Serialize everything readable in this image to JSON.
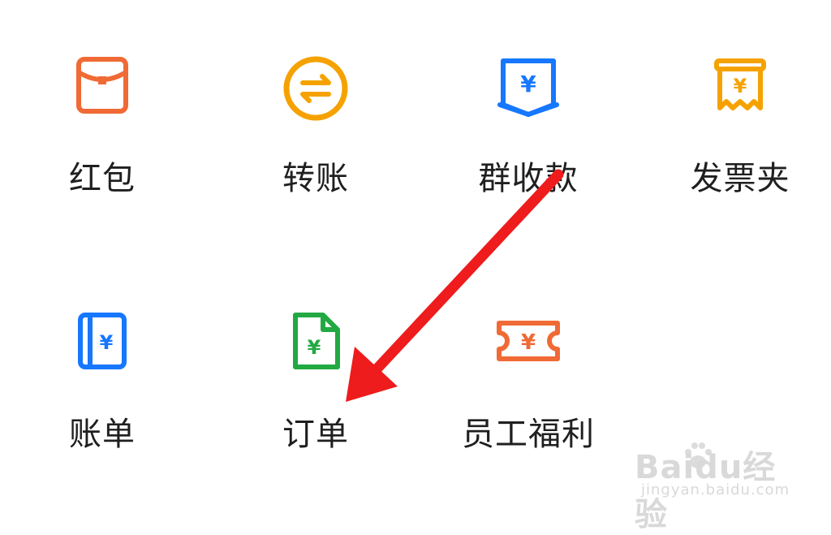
{
  "grid": {
    "items": [
      {
        "label": "红包",
        "icon": "red-packet-icon",
        "color": "#f06a35"
      },
      {
        "label": "转账",
        "icon": "transfer-icon",
        "color": "#f5a200"
      },
      {
        "label": "群收款",
        "icon": "group-collect-icon",
        "color": "#1677ff"
      },
      {
        "label": "发票夹",
        "icon": "invoice-folder-icon",
        "color": "#f5a200"
      },
      {
        "label": "账单",
        "icon": "bill-icon",
        "color": "#1677ff"
      },
      {
        "label": "订单",
        "icon": "order-icon",
        "color": "#22a942"
      },
      {
        "label": "员工福利",
        "icon": "employee-benefit-icon",
        "color": "#f06a35"
      }
    ]
  },
  "annotation": {
    "type": "arrow",
    "color": "#ee1c1c"
  },
  "watermark": {
    "main": "Baidu经验",
    "sub": "jingyan.baidu.com"
  }
}
